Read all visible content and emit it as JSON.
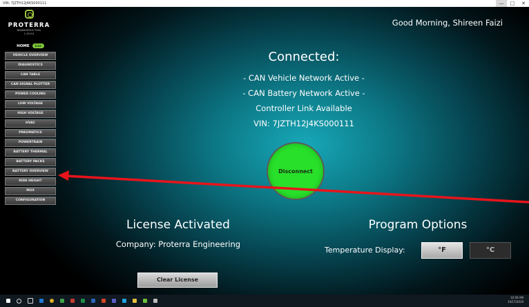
{
  "window": {
    "title": "VIN: 7JZTH12J4KS000111",
    "controls": {
      "minimize": "—",
      "maximize": "□",
      "close": "✕"
    }
  },
  "logo": {
    "icon": "proterra-logo-icon",
    "name": "PROTERRA",
    "subtitle": "DIAGNOSTICS TOOL",
    "version": "1.15.0.0",
    "color": "#9ec43c"
  },
  "sidebar": {
    "home": {
      "label": "HOME",
      "badge": "Live"
    },
    "items": [
      {
        "label": "VEHICLE OVERVIEW"
      },
      {
        "label": "DIAGNOSTICS"
      },
      {
        "label": "CAN TABLE"
      },
      {
        "label": "CAN SIGNAL PLOTTER"
      },
      {
        "label": "POWER COOLING"
      },
      {
        "label": "LOW VOLTAGE"
      },
      {
        "label": "HIGH VOLTAGE"
      },
      {
        "label": "HVAC"
      },
      {
        "label": "PNEUMATICS"
      },
      {
        "label": "POWERTRAIN"
      },
      {
        "label": "BATTERY THERMAL"
      },
      {
        "label": "BATTERY PACKS"
      },
      {
        "label": "BATTERY OVERVIEW"
      },
      {
        "label": "RIDE HEIGHT"
      },
      {
        "label": "MUX"
      },
      {
        "label": "CONFIGURATION"
      }
    ]
  },
  "header": {
    "greeting": "Good Morning, Shireen Faizi"
  },
  "status": {
    "title": "Connected:",
    "lines": [
      "- CAN Vehicle Network Active -",
      "- CAN Battery Network Active -",
      "Controller Link Available",
      "VIN: 7JZTH12J4KS000111"
    ],
    "button_label": "Disconnect",
    "button_color": "#28e02a"
  },
  "license": {
    "title": "License Activated",
    "company": "Company: Proterra Engineering",
    "clear_label": "Clear License"
  },
  "program_options": {
    "title": "Program Options",
    "temperature_label": "Temperature Display:",
    "fahrenheit": "°F",
    "celsius": "°C",
    "selected": "°F"
  },
  "annotation": {
    "arrow_color": "#e8141b"
  },
  "taskbar": {
    "icons": [
      "windows-start-icon",
      "search-icon",
      "task-view-icon",
      "edge-icon",
      "chrome-icon",
      "app-icon",
      "outlook-icon",
      "excel-icon",
      "word-icon",
      "powerpoint-icon",
      "teams-icon",
      "skype-icon",
      "explorer-icon",
      "app-icon",
      "settings-icon"
    ],
    "time": "10:59 AM",
    "date": "10/17/2019"
  }
}
